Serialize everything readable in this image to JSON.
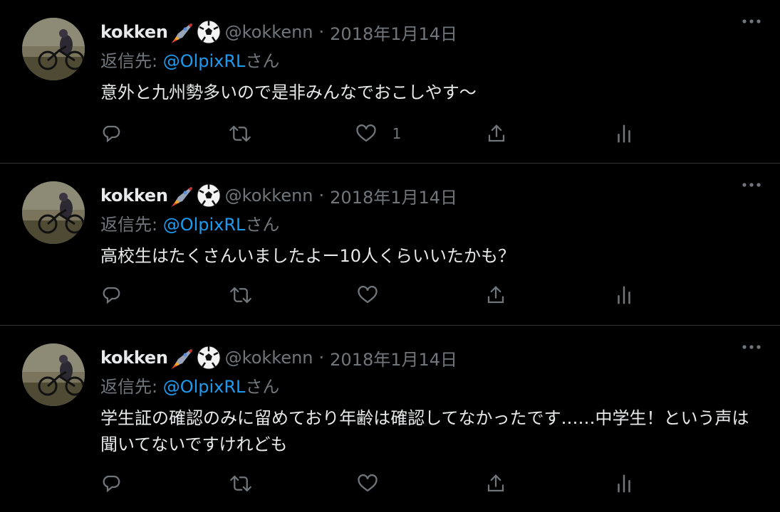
{
  "tweets": [
    {
      "name": "kokken",
      "handle": "@kokkenn",
      "dot": "·",
      "date": "2018年1月14日",
      "reply_prefix": "返信先: ",
      "reply_mention": "@OlpixRL",
      "reply_suffix": "さん",
      "text": "意外と九州勢多いので是非みんなでおこしやす〜",
      "like_count": "1"
    },
    {
      "name": "kokken",
      "handle": "@kokkenn",
      "dot": "·",
      "date": "2018年1月14日",
      "reply_prefix": "返信先: ",
      "reply_mention": "@OlpixRL",
      "reply_suffix": "さん",
      "text": "高校生はたくさんいましたよー10人くらいいたかも？",
      "like_count": ""
    },
    {
      "name": "kokken",
      "handle": "@kokkenn",
      "dot": "·",
      "date": "2018年1月14日",
      "reply_prefix": "返信先: ",
      "reply_mention": "@OlpixRL",
      "reply_suffix": "さん",
      "text": "学生証の確認のみに留めており年齢は確認してなかったです……中学生！という声は聞いてないですけれども",
      "like_count": ""
    }
  ],
  "icons": {
    "name_badges": [
      "rocket-icon",
      "soccer-ball-icon"
    ],
    "more": "more-options-icon",
    "reply": "reply-icon",
    "retweet": "retweet-icon",
    "like": "heart-icon",
    "share": "share-icon",
    "analytics": "analytics-icon"
  },
  "colors": {
    "background": "#000000",
    "text": "#e7e9ea",
    "muted": "#71767b",
    "mention": "#1d9bf0",
    "divider": "#2f3336"
  }
}
